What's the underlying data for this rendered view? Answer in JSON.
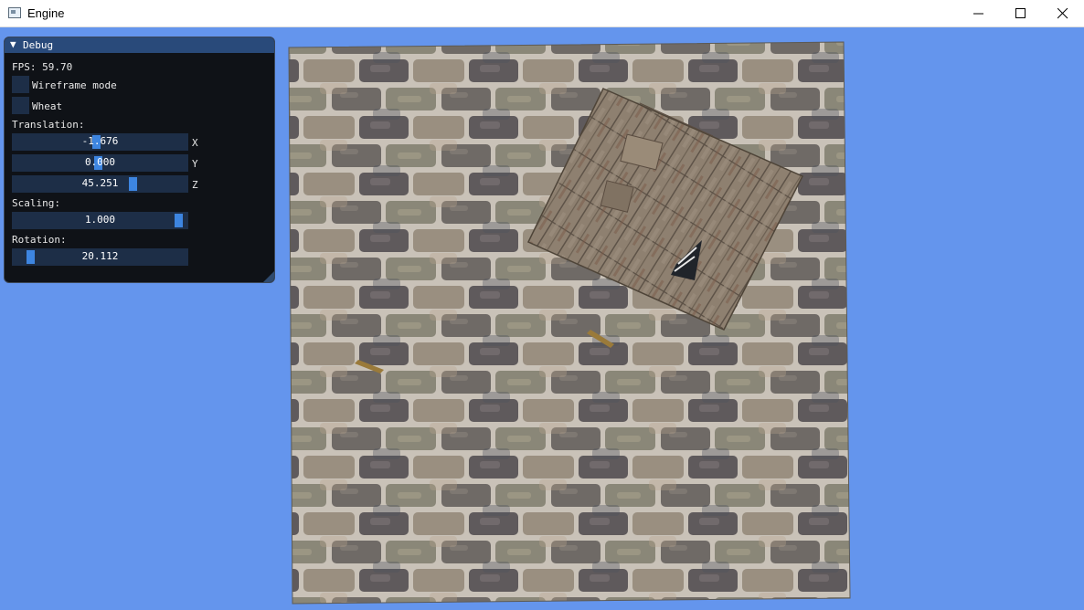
{
  "window": {
    "title": "Engine",
    "icon": "app-window-icon",
    "controls": [
      "minimize-icon",
      "maximize-icon",
      "close-icon"
    ]
  },
  "colors": {
    "clear_color": "#6495ed",
    "panel_bg": "#0f1217",
    "panel_header": "#294a7a",
    "frame_bg": "#1d2e47",
    "slider_grab": "#3d85e0"
  },
  "debug": {
    "title": "Debug",
    "fps_label": "FPS: 59.70",
    "wireframe_label": "Wireframe mode",
    "wireframe_checked": false,
    "wheat_label": "Wheat",
    "wheat_checked": false,
    "translation_label": "Translation:",
    "translation": {
      "x": {
        "value": "-1.676",
        "axis": "X",
        "fraction": 0.48
      },
      "y": {
        "value": "0.000",
        "axis": "Y",
        "fraction": 0.49
      },
      "z": {
        "value": "45.251",
        "axis": "Z",
        "fraction": 0.7
      }
    },
    "scaling_label": "Scaling:",
    "scaling": {
      "value": "1.000",
      "fraction": 0.98
    },
    "rotation_label": "Rotation:",
    "rotation": {
      "value": "20.112",
      "fraction": 0.08
    }
  },
  "scene": {
    "background_object": "brick-wall-textured-quad",
    "foreground_object": "wooden-house-model"
  }
}
